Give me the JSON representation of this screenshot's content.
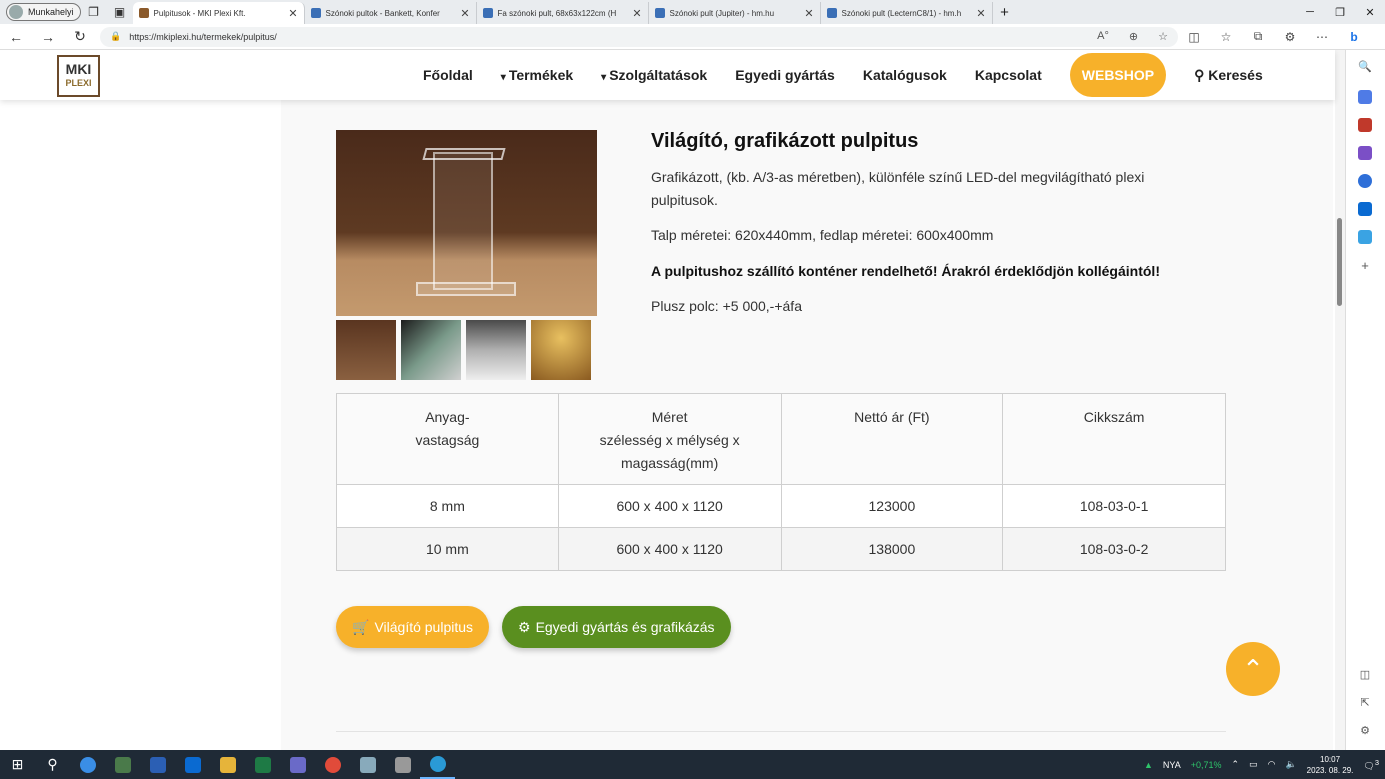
{
  "browser": {
    "profile": "Munkahelyi",
    "tabs": [
      {
        "label": "Pulpitusok - MKI Plexi Kft.",
        "active": true
      },
      {
        "label": "Szónoki pultok - Bankett, Konfer"
      },
      {
        "label": "Fa szónoki pult, 68x63x122cm (H"
      },
      {
        "label": "Szónoki pult (Jupiter) - hm.hu"
      },
      {
        "label": "Szónoki pult (LecternC8/1) - hm.h"
      }
    ],
    "url_prefix": "https://",
    "url_host": "mkiplexi.hu",
    "url_path": "/termekek/pulpitus/"
  },
  "header": {
    "logo_line1": "MKI",
    "logo_line2": "PLEXI",
    "menu": {
      "home": "Főoldal",
      "products": "Termékek",
      "services": "Szolgáltatások",
      "custom": "Egyedi gyártás",
      "catalogs": "Katalógusok",
      "contact": "Kapcsolat",
      "webshop": "WEBSHOP",
      "search": "Keresés"
    }
  },
  "product": {
    "title": "Világító, grafikázott pulpitus",
    "desc": "Grafikázott,  (kb. A/3-as méretben), különféle színű LED-del megvilágítható plexi pulpitusok.",
    "dims": "Talp méretei: 620x440mm, fedlap méretei: 600x400mm",
    "notice": "A pulpitushoz szállító konténer rendelhető! Árakról érdeklődjön kollégáintól!",
    "extra": "Plusz polc: +5 000,-+áfa"
  },
  "table": {
    "headers": [
      [
        "Anyag-",
        "vastagság"
      ],
      [
        "Méret",
        "szélesség x mélység x",
        "magasság(mm)"
      ],
      [
        "Nettó ár (Ft)"
      ],
      [
        "Cikkszám"
      ]
    ],
    "rows": [
      [
        "8 mm",
        "600 x 400 x 1120",
        "123000",
        "108-03-0-1"
      ],
      [
        "10 mm",
        "600 x 400 x 1120",
        "138000",
        "108-03-0-2"
      ]
    ]
  },
  "buttons": {
    "shop": "Világító pulpitus",
    "custom": "Egyedi gyártás és grafikázás"
  },
  "taskbar": {
    "lang": "NYA",
    "stock": "+0,71%",
    "time": "10:07",
    "date": "2023. 08. 29.",
    "notif": "3"
  },
  "colors": {
    "accent": "#f7b12a",
    "green": "#5a8f1f"
  }
}
